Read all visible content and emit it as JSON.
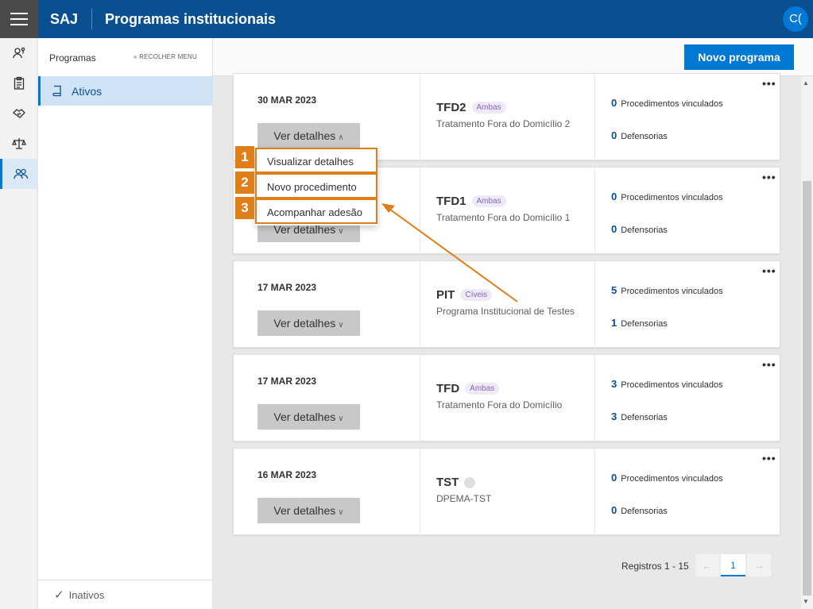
{
  "topbar": {
    "brand": "SAJ",
    "title": "Programas institucionais",
    "avatar_initials": "C("
  },
  "rail": {
    "icons": [
      "person-key-icon",
      "clipboard-icon",
      "handshake-icon",
      "scales-icon",
      "people-icon"
    ],
    "active_index": 4
  },
  "sidepanel": {
    "title": "Programas",
    "collapse_label": "RECOLHER MENU",
    "active_item": "Ativos",
    "bottom_item": "Inativos"
  },
  "toolbar": {
    "new_program_label": "Novo programa"
  },
  "cards": [
    {
      "date": "30 MAR 2023",
      "details_label": "Ver detalhes",
      "code": "TFD2",
      "tag": "Ambas",
      "name": "Tratamento Fora do Domicílio 2",
      "procedures": "0",
      "procedures_label": "Procedimentos vinculados",
      "defensorias": "0",
      "defensorias_label": "Defensorias"
    },
    {
      "date": "",
      "details_label": "Ver detalhes",
      "code": "TFD1",
      "tag": "Ambas",
      "name": "Tratamento Fora do Domicílio 1",
      "procedures": "0",
      "procedures_label": "Procedimentos vinculados",
      "defensorias": "0",
      "defensorias_label": "Defensorias"
    },
    {
      "date": "17 MAR 2023",
      "details_label": "Ver detalhes",
      "code": "PIT",
      "tag": "Cíveis",
      "name": "Programa Institucional de Testes",
      "procedures": "5",
      "procedures_label": "Procedimentos vinculados",
      "defensorias": "1",
      "defensorias_label": "Defensorias"
    },
    {
      "date": "17 MAR 2023",
      "details_label": "Ver detalhes",
      "code": "TFD",
      "tag": "Ambas",
      "name": "Tratamento Fora do Domicílio",
      "procedures": "3",
      "procedures_label": "Procedimentos vinculados",
      "defensorias": "3",
      "defensorias_label": "Defensorias"
    },
    {
      "date": "16 MAR 2023",
      "details_label": "Ver detalhes",
      "code": "TST",
      "tag": "",
      "name": "DPEMA-TST",
      "procedures": "0",
      "procedures_label": "Procedimentos vinculados",
      "defensorias": "0",
      "defensorias_label": "Defensorias"
    }
  ],
  "menu": {
    "items": [
      {
        "number": "1",
        "label": "Visualizar detalhes"
      },
      {
        "number": "2",
        "label": "Novo procedimento"
      },
      {
        "number": "3",
        "label": "Acompanhar adesão"
      }
    ]
  },
  "pagination": {
    "label": "Registros 1 - 15",
    "current_page": "1"
  },
  "colors": {
    "brand": "#0a4f8f",
    "accent": "#0078d4",
    "annotation": "#e07e1b"
  }
}
